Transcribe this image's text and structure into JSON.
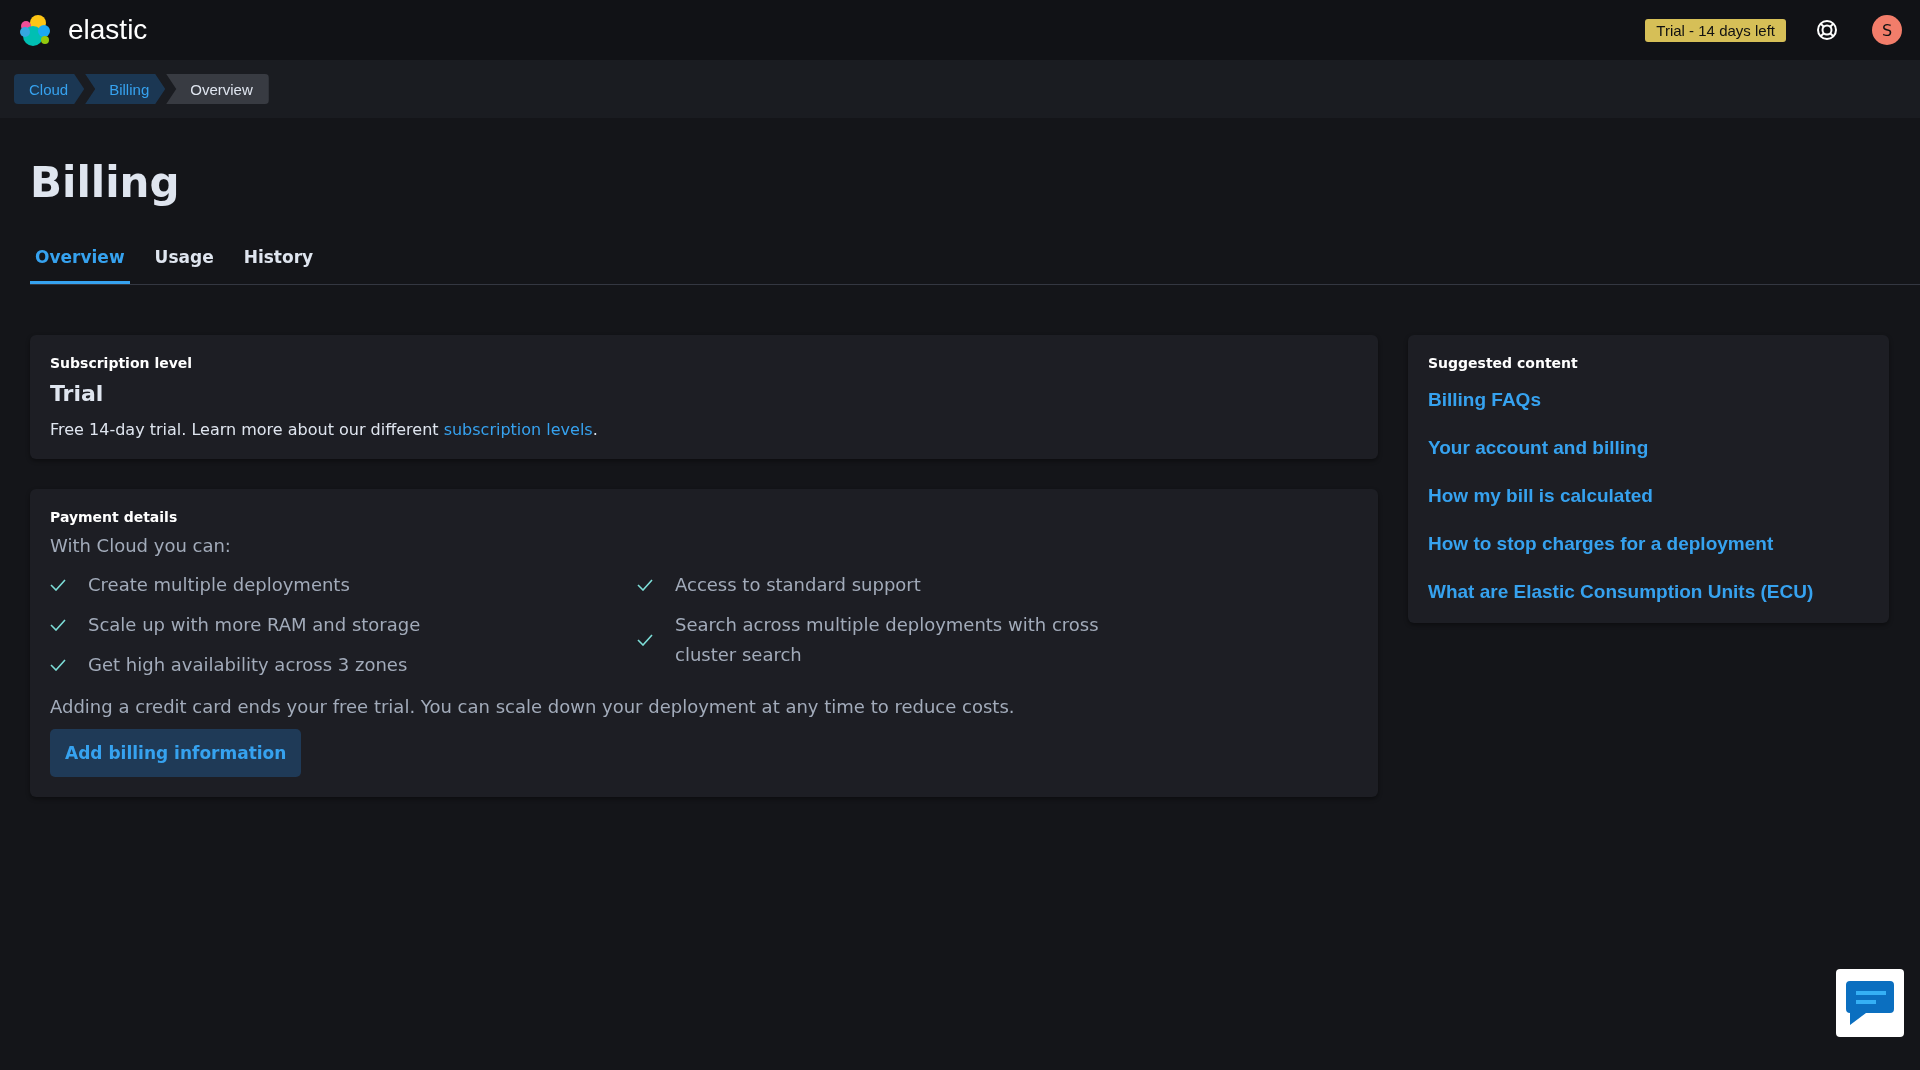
{
  "header": {
    "brand": "elastic",
    "trial_badge": "Trial - 14 days left",
    "avatar": "S"
  },
  "breadcrumbs": [
    {
      "label": "Cloud",
      "current": false
    },
    {
      "label": "Billing",
      "current": false
    },
    {
      "label": "Overview",
      "current": true
    }
  ],
  "page_title": "Billing",
  "tabs": [
    {
      "label": "Overview",
      "selected": true
    },
    {
      "label": "Usage",
      "selected": false
    },
    {
      "label": "History",
      "selected": false
    }
  ],
  "subscription": {
    "heading": "Subscription level",
    "level": "Trial",
    "text": "Free 14-day trial. Learn more about our different ",
    "link": "subscription levels",
    "after": "."
  },
  "payment": {
    "heading": "Payment details",
    "intro": "With Cloud you can:",
    "features_left": [
      "Create multiple deployments",
      "Scale up with more RAM and storage",
      "Get high availability across 3 zones"
    ],
    "features_right": [
      "Access to standard support",
      "Search across multiple deployments with cross cluster search"
    ],
    "note": "Adding a credit card ends your free trial. You can scale down your deployment at any time to reduce costs.",
    "button": "Add billing information"
  },
  "suggested": {
    "heading": "Suggested content",
    "links": [
      "Billing FAQs",
      "Your account and billing",
      "How my bill is calculated",
      "How to stop charges for a deployment",
      "What are Elastic Consumption Units (ECU)"
    ]
  }
}
